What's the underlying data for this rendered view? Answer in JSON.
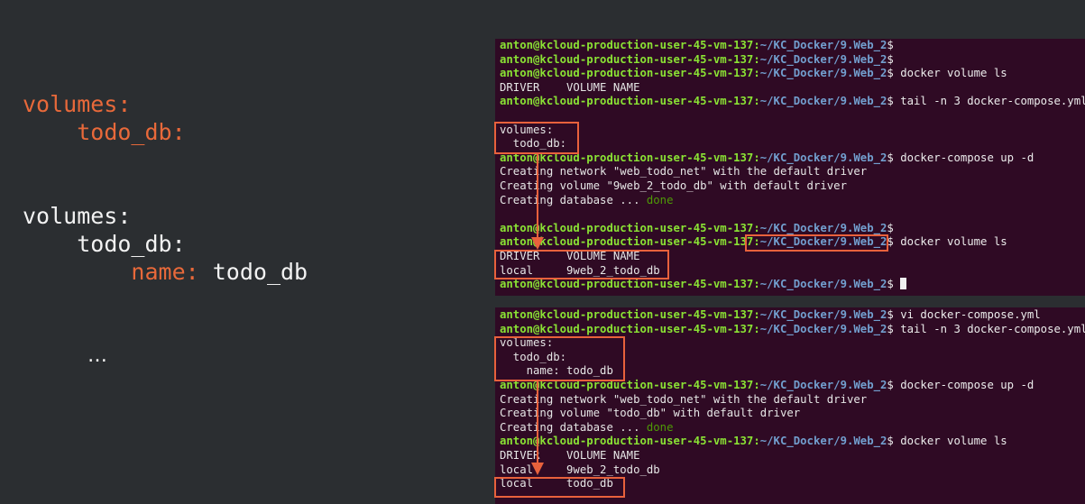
{
  "slide": {
    "block_a": {
      "volumes_key": "volumes:",
      "todo_db_key": "todo_db:"
    },
    "block_b": {
      "volumes_key": "volumes:",
      "todo_db_key": "todo_db:",
      "name_key": "name:",
      "name_value": "todo_db"
    },
    "ellipsis": "…"
  },
  "terminal1": {
    "lines": [
      {
        "prompt": "anton@kcloud-production-user-45-vm-137:",
        "path": "~/KC_Docker/9.Web_2",
        "cmd": "$"
      },
      {
        "prompt": "anton@kcloud-production-user-45-vm-137:",
        "path": "~/KC_Docker/9.Web_2",
        "cmd": "$"
      },
      {
        "prompt": "anton@kcloud-production-user-45-vm-137:",
        "path": "~/KC_Docker/9.Web_2",
        "cmd": "$ docker volume ls"
      },
      {
        "text": "DRIVER    VOLUME NAME"
      },
      {
        "prompt": "anton@kcloud-production-user-45-vm-137:",
        "path": "~/KC_Docker/9.Web_2",
        "cmd": "$ tail -n 3 docker-compose.yml"
      },
      {
        "text": ""
      },
      {
        "text": "volumes:"
      },
      {
        "text": "  todo_db:"
      },
      {
        "prompt": "anton@kcloud-production-user-45-vm-137:",
        "path": "~/KC_Docker/9.Web_2",
        "cmd": "$ docker-compose up -d"
      },
      {
        "text": "Creating network \"web_todo_net\" with the default driver"
      },
      {
        "text": "Creating volume \"9web_2_todo_db\" with default driver"
      },
      {
        "text": "Creating database ... ",
        "status": "done"
      },
      {
        "text": ""
      },
      {
        "prompt": "anton@kcloud-production-user-45-vm-137:",
        "path": "~/KC_Docker/9.Web_2",
        "cmd": "$"
      },
      {
        "prompt": "anton@kcloud-production-user-45-vm-137:",
        "path": "~/KC_Docker/9.Web_2",
        "cmd": "$ docker volume ls"
      },
      {
        "text": "DRIVER    VOLUME NAME"
      },
      {
        "text": "local     9web_2_todo_db"
      },
      {
        "prompt": "anton@kcloud-production-user-45-vm-137:",
        "path": "~/KC_Docker/9.Web_2",
        "cmd": "$ ",
        "cursor": true
      }
    ]
  },
  "terminal2": {
    "lines": [
      {
        "prompt": "anton@kcloud-production-user-45-vm-137:",
        "path": "~/KC_Docker/9.Web_2",
        "cmd": "$ vi docker-compose.yml"
      },
      {
        "prompt": "anton@kcloud-production-user-45-vm-137:",
        "path": "~/KC_Docker/9.Web_2",
        "cmd": "$ tail -n 3 docker-compose.yml"
      },
      {
        "text": "volumes:"
      },
      {
        "text": "  todo_db:"
      },
      {
        "text": "    name: todo_db"
      },
      {
        "prompt": "anton@kcloud-production-user-45-vm-137:",
        "path": "~/KC_Docker/9.Web_2",
        "cmd": "$ docker-compose up -d"
      },
      {
        "text": "Creating network \"web_todo_net\" with the default driver"
      },
      {
        "text": "Creating volume \"todo_db\" with default driver"
      },
      {
        "text": "Creating database ... ",
        "status": "done"
      },
      {
        "prompt": "anton@kcloud-production-user-45-vm-137:",
        "path": "~/KC_Docker/9.Web_2",
        "cmd": "$ docker volume ls"
      },
      {
        "text": "DRIVER    VOLUME NAME"
      },
      {
        "text": "local     9web_2_todo_db"
      },
      {
        "text": "local     todo_db"
      }
    ]
  },
  "colors": {
    "slide_bg": "#2b2e31",
    "accent": "#e8693a",
    "terminal_bg": "#2f0a24",
    "prompt": "#8ae234",
    "path": "#729fcf",
    "highlight": "#e8613c"
  }
}
